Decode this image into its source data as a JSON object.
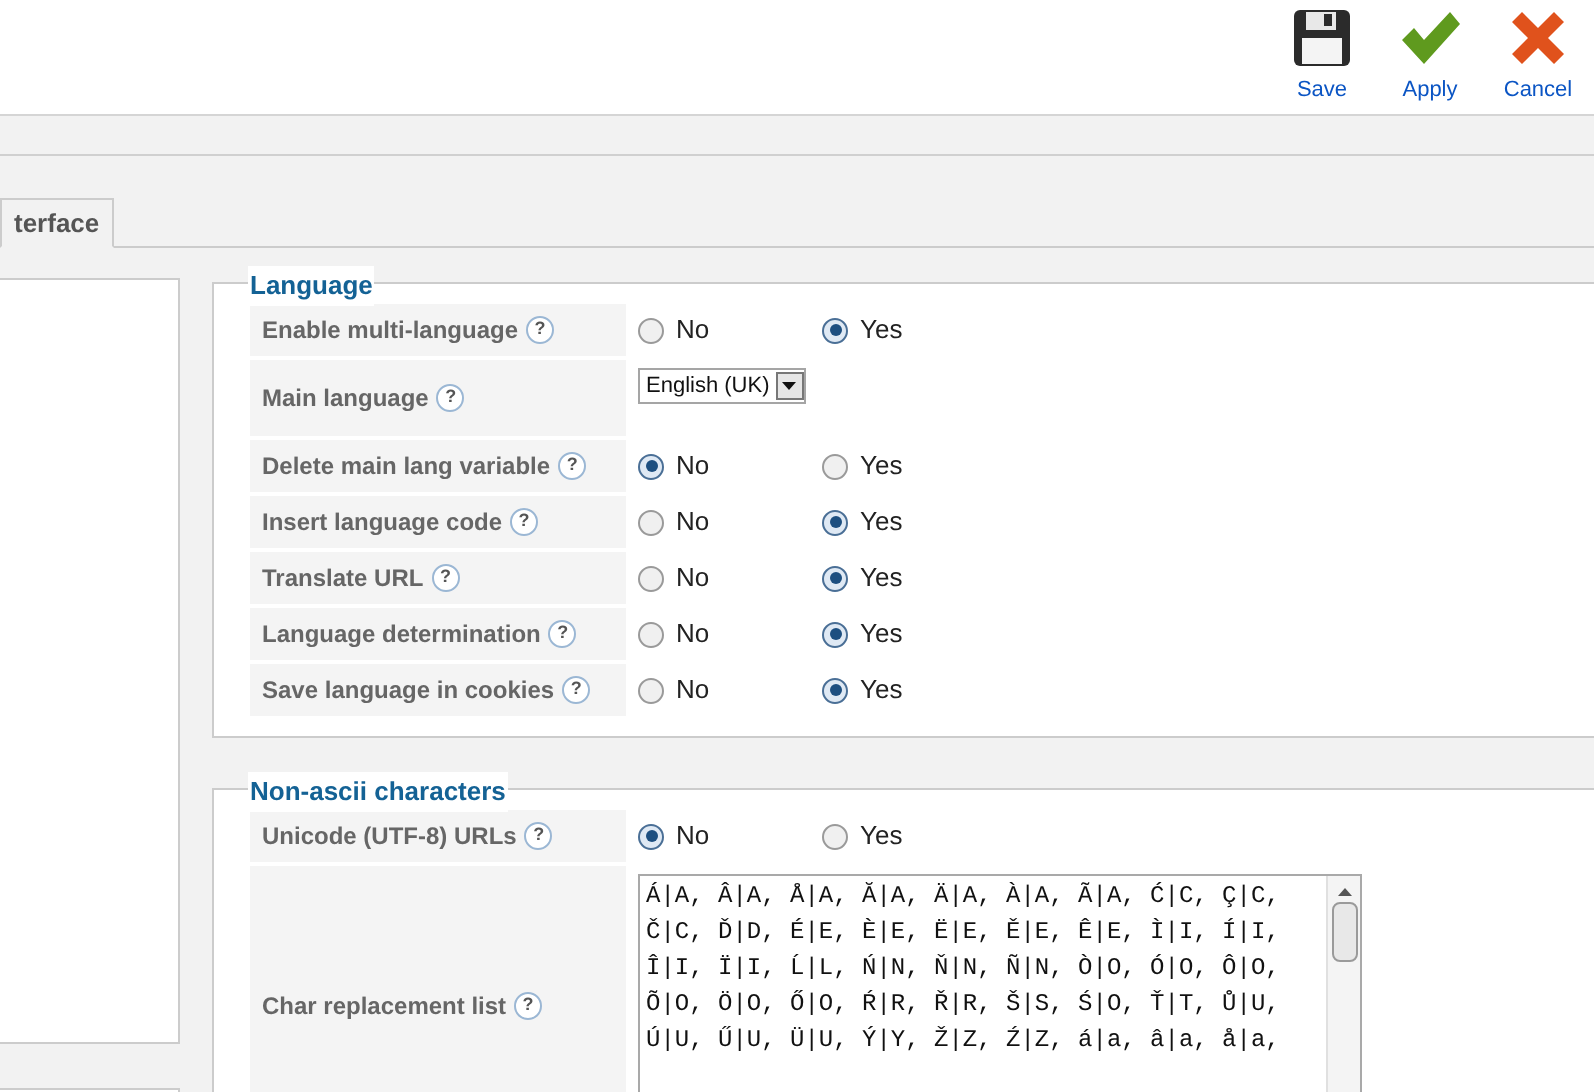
{
  "toolbar": {
    "buttons": [
      {
        "kind": "save",
        "label": "Save"
      },
      {
        "kind": "apply",
        "label": "Apply"
      },
      {
        "kind": "cancel",
        "label": "Cancel"
      }
    ]
  },
  "tabs": [
    {
      "label": "terface",
      "selected": true
    }
  ],
  "fieldsets": [
    {
      "legend": "Language",
      "rows": [
        {
          "kind": "radio",
          "label": "Enable multi-language",
          "help": "?",
          "options": [
            {
              "label": "No",
              "selected": false
            },
            {
              "label": "Yes",
              "selected": true
            }
          ]
        },
        {
          "kind": "select",
          "label": "Main language",
          "help": "?",
          "value": "English (UK)"
        },
        {
          "kind": "radio",
          "label": "Delete main lang variable",
          "help": "?",
          "options": [
            {
              "label": "No",
              "selected": true
            },
            {
              "label": "Yes",
              "selected": false
            }
          ]
        },
        {
          "kind": "radio",
          "label": "Insert language code",
          "help": "?",
          "options": [
            {
              "label": "No",
              "selected": false
            },
            {
              "label": "Yes",
              "selected": true
            }
          ]
        },
        {
          "kind": "radio",
          "label": "Translate URL",
          "help": "?",
          "options": [
            {
              "label": "No",
              "selected": false
            },
            {
              "label": "Yes",
              "selected": true
            }
          ]
        },
        {
          "kind": "radio",
          "label": "Language determination",
          "help": "?",
          "options": [
            {
              "label": "No",
              "selected": false
            },
            {
              "label": "Yes",
              "selected": true
            }
          ]
        },
        {
          "kind": "radio",
          "label": "Save language in cookies",
          "help": "?",
          "options": [
            {
              "label": "No",
              "selected": false
            },
            {
              "label": "Yes",
              "selected": true
            }
          ]
        }
      ]
    },
    {
      "legend": "Non-ascii characters",
      "rows": [
        {
          "kind": "radio",
          "label": "Unicode (UTF-8) URLs",
          "help": "?",
          "options": [
            {
              "label": "No",
              "selected": true
            },
            {
              "label": "Yes",
              "selected": false
            }
          ]
        },
        {
          "kind": "textarea",
          "label": "Char replacement list",
          "help": "?",
          "value": "Á|A, Â|A, Å|A, Ă|A, Ä|A, À|A, Ã|A, Ć|C, Ç|C,\nČ|C, Ď|D, É|E, È|E, Ë|E, Ě|E, Ê|E, Ì|I, Í|I,\nÎ|I, Ï|I, Ĺ|L, Ń|N, Ň|N, Ñ|N, Ò|O, Ó|O, Ô|O,\nÕ|O, Ö|O, Ő|O, Ŕ|R, Ř|R, Š|S, Ś|O, Ť|T, Ů|U,\nÚ|U, Ű|U, Ü|U, Ý|Y, Ž|Z, Ź|Z, á|a, â|a, å|a,"
        }
      ]
    }
  ]
}
